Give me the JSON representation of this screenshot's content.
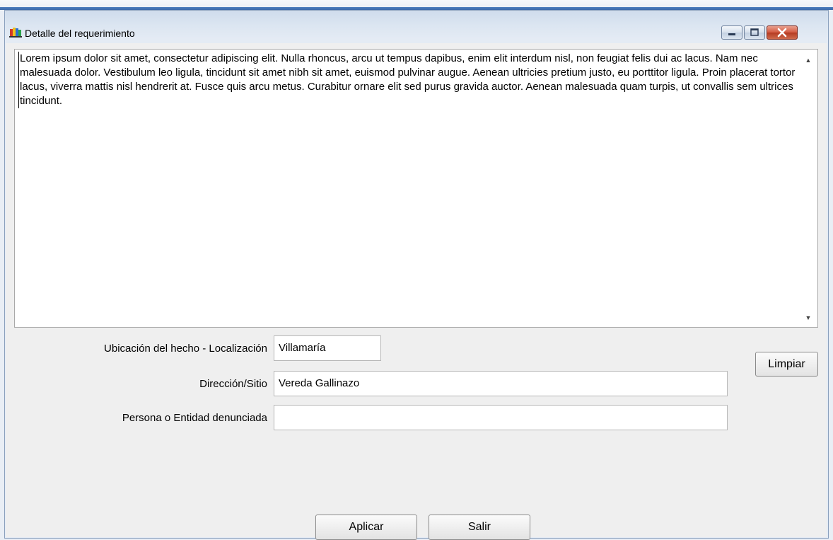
{
  "window": {
    "title": "Detalle del requerimiento",
    "controls": [
      "minimize-icon",
      "maximize-icon",
      "close-icon"
    ]
  },
  "description": {
    "text": "Lorem ipsum dolor sit amet, consectetur adipiscing elit. Nulla rhoncus, arcu ut tempus dapibus, enim elit interdum nisl, non feugiat felis dui ac lacus. Nam nec malesuada dolor. Vestibulum leo ligula, tincidunt sit amet nibh sit amet, euismod pulvinar augue. Aenean ultricies pretium justo, eu porttitor ligula. Proin placerat tortor lacus, viverra mattis nisl hendrerit at. Fusce quis arcu metus. Curabitur ornare elit sed purus gravida auctor. Aenean malesuada quam turpis, ut convallis sem ultrices tincidunt."
  },
  "form": {
    "ubicacion_label": "Ubicación del hecho - Localización",
    "ubicacion_value": "Villamaría",
    "direccion_label": "Dirección/Sitio",
    "direccion_value": "Vereda Gallinazo",
    "persona_label": "Persona o Entidad denunciada",
    "persona_value": ""
  },
  "buttons": {
    "limpiar": "Limpiar",
    "aplicar": "Aplicar",
    "salir": "Salir"
  },
  "colors": {
    "titlebar": "#d6e2f0",
    "client_bg": "#efefef",
    "close_button": "#c8452d"
  }
}
